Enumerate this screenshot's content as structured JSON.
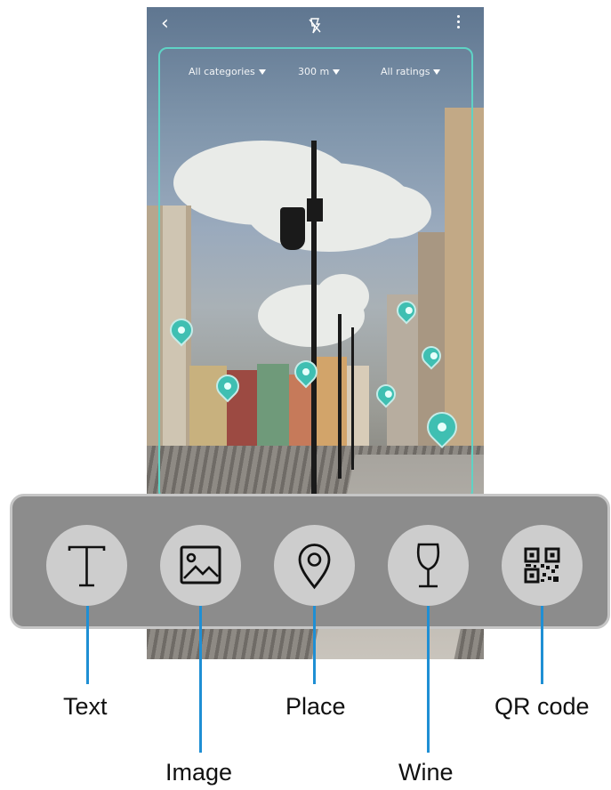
{
  "camera_view": {
    "filters": [
      {
        "label": "All categories"
      },
      {
        "label": "300 m"
      },
      {
        "label": "All ratings"
      }
    ]
  },
  "icons": {
    "back": "back-arrow-icon",
    "flash": "flash-off-icon",
    "more": "more-options-icon"
  },
  "tools": [
    {
      "id": "text",
      "label": "Text",
      "icon": "text-icon"
    },
    {
      "id": "image",
      "label": "Image",
      "icon": "image-icon"
    },
    {
      "id": "place",
      "label": "Place",
      "icon": "location-pin-icon"
    },
    {
      "id": "wine",
      "label": "Wine",
      "icon": "wine-glass-icon"
    },
    {
      "id": "qr",
      "label": "QR code",
      "icon": "qr-code-icon"
    }
  ],
  "colors": {
    "accent": "#5fd3c5",
    "pin": "#3fbfb2",
    "callout_line": "#1f8fd4",
    "toolbar": "#8c8c8c",
    "tool_button": "#cdcdcd"
  }
}
